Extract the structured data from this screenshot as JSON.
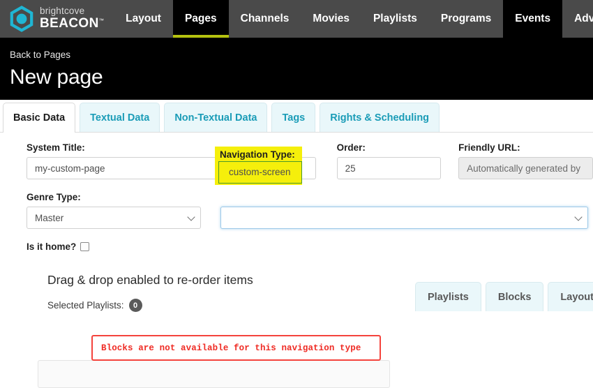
{
  "brand": {
    "logo_icon": "brightcove-hexagon-icon",
    "name_top": "brightcove",
    "name_bottom": "BEACON",
    "trademark": "™",
    "accent_cyan": "#1fb6d4",
    "accent_olive": "#b5c20f"
  },
  "topnav": {
    "items": [
      {
        "label": "Layout",
        "state": "default"
      },
      {
        "label": "Pages",
        "state": "active"
      },
      {
        "label": "Channels",
        "state": "default"
      },
      {
        "label": "Movies",
        "state": "default"
      },
      {
        "label": "Playlists",
        "state": "default"
      },
      {
        "label": "Programs",
        "state": "default"
      },
      {
        "label": "Events",
        "state": "hovered"
      },
      {
        "label": "Advertisement",
        "state": "default"
      }
    ]
  },
  "pageheader": {
    "back_label": "Back to Pages",
    "title": "New page"
  },
  "tabs": [
    {
      "label": "Basic Data",
      "active": true
    },
    {
      "label": "Textual Data",
      "active": false
    },
    {
      "label": "Non-Textual Data",
      "active": false
    },
    {
      "label": "Tags",
      "active": false
    },
    {
      "label": "Rights & Scheduling",
      "active": false
    }
  ],
  "form": {
    "system_title": {
      "label": "System Title:",
      "value": "my-custom-page"
    },
    "order": {
      "label": "Order:",
      "value": "25"
    },
    "friendly_url": {
      "label": "Friendly URL:",
      "placeholder": "Automatically generated by",
      "disabled": true
    },
    "genre_type": {
      "label": "Genre Type:",
      "value": "Master"
    },
    "navigation_type": {
      "label": "Navigation Type:",
      "value": "custom-screen",
      "highlighted": true,
      "highlight_color": "#f5ef0b",
      "callout_border_color": "#4c9a2a"
    },
    "is_home": {
      "label": "Is it home?",
      "checked": false
    }
  },
  "content": {
    "drag_drop_title": "Drag & drop enabled to re-order items",
    "selected_playlists_label": "Selected Playlists:",
    "selected_playlists_count": "0"
  },
  "panel_tabs": [
    {
      "label": "Playlists"
    },
    {
      "label": "Blocks"
    },
    {
      "label": "Layouts"
    }
  ],
  "warning": {
    "message": "Blocks are not available for this navigation type",
    "border_color": "#f4433c",
    "text_color": "#ef2b24"
  }
}
